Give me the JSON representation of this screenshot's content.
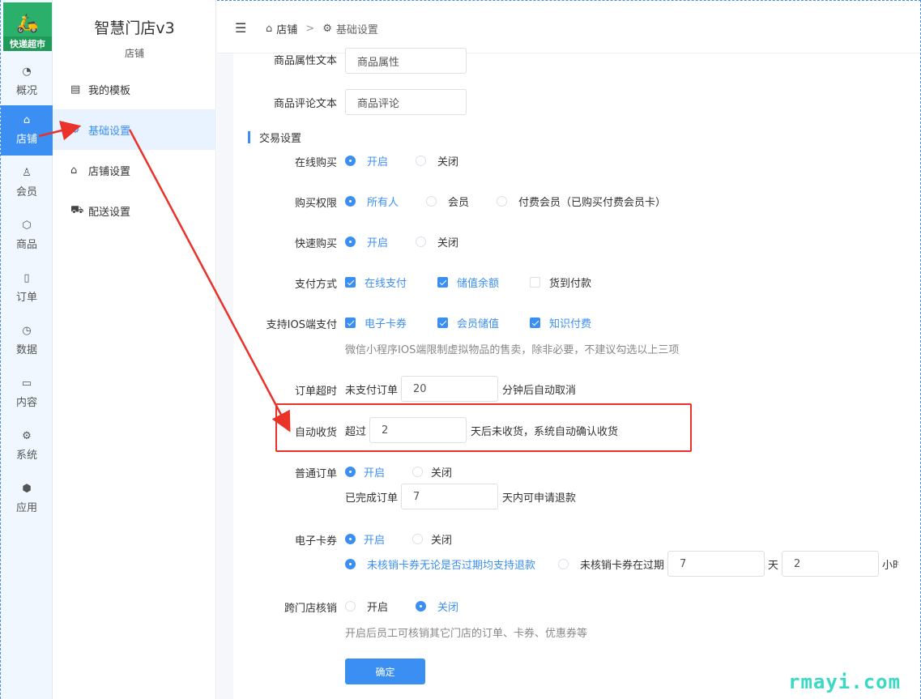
{
  "brand": {
    "logo_text": "快递超市",
    "app_title": "智慧门店v3",
    "section": "店铺"
  },
  "rail": [
    {
      "icon": "dashboard-icon",
      "label": "概况"
    },
    {
      "icon": "store-icon",
      "label": "店铺"
    },
    {
      "icon": "user-icon",
      "label": "会员"
    },
    {
      "icon": "box-icon",
      "label": "商品"
    },
    {
      "icon": "clipboard-icon",
      "label": "订单"
    },
    {
      "icon": "pie-chart-icon",
      "label": "数据"
    },
    {
      "icon": "folder-icon",
      "label": "内容"
    },
    {
      "icon": "gear-icon",
      "label": "系统"
    },
    {
      "icon": "cube-icon",
      "label": "应用"
    }
  ],
  "submenu": [
    {
      "icon": "table-icon",
      "label": "我的模板"
    },
    {
      "icon": "gear-icon",
      "label": "基础设置"
    },
    {
      "icon": "store-settings-icon",
      "label": "店铺设置"
    },
    {
      "icon": "truck-icon",
      "label": "配送设置"
    }
  ],
  "breadcrumb": {
    "first": "店铺",
    "sep": ">",
    "second": "基础设置"
  },
  "form": {
    "attr_text": {
      "label": "商品属性文本",
      "value": "商品属性"
    },
    "review_text": {
      "label": "商品评论文本",
      "value": "商品评论"
    },
    "trade_section": "交易设置",
    "online_buy": {
      "label": "在线购买",
      "on": "开启",
      "off": "关闭"
    },
    "buy_permission": {
      "label": "购买权限",
      "opt1": "所有人",
      "opt2": "会员",
      "opt3": "付费会员（已购买付费会员卡）"
    },
    "quick_buy": {
      "label": "快速购买",
      "on": "开启",
      "off": "关闭"
    },
    "pay_method": {
      "label": "支付方式",
      "opt1": "在线支付",
      "opt2": "储值余额",
      "opt3": "货到付款"
    },
    "ios_pay": {
      "label": "支持IOS端支付",
      "opt1": "电子卡券",
      "opt2": "会员储值",
      "opt3": "知识付费",
      "hint": "微信小程序IOS端限制虚拟物品的售卖，除非必要，不建议勾选以上三项"
    },
    "order_timeout": {
      "label": "订单超时",
      "prefix": "未支付订单",
      "value": "20",
      "suffix": "分钟后自动取消"
    },
    "auto_receive": {
      "label": "自动收货",
      "prefix": "超过",
      "value": "2",
      "suffix": "天后未收货，系统自动确认收货"
    },
    "normal_order": {
      "label": "普通订单",
      "on": "开启",
      "off": "关闭",
      "prefix": "已完成订单",
      "value": "7",
      "suffix": "天内可申请退款"
    },
    "ecard": {
      "label": "电子卡券",
      "on": "开启",
      "off": "关闭",
      "refund_opt1": "未核销卡券无论是否过期均支持退款",
      "refund_opt2": "未核销卡券在过期",
      "days_value": "7",
      "days_unit": "天",
      "hours_value": "2",
      "hours_unit": "小时"
    },
    "cross_store": {
      "label": "跨门店核销",
      "on": "开启",
      "off": "关闭",
      "hint": "开启后员工可核销其它门店的订单、卡券、优惠券等"
    },
    "confirm": "确定"
  },
  "watermark": "rmayi.com"
}
